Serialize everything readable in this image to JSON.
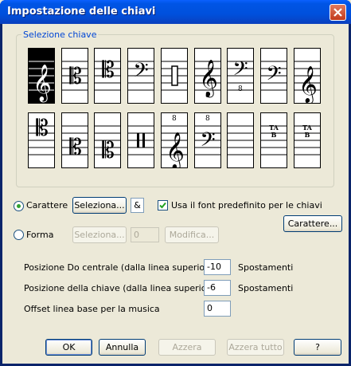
{
  "window": {
    "title": "Impostazione delle chiavi"
  },
  "clef_group": {
    "label": "Selezione chiave",
    "tiles": [
      {
        "name": "treble-clef",
        "selected": true
      },
      {
        "name": "alto-clef"
      },
      {
        "name": "tenor-clef"
      },
      {
        "name": "bass-clef"
      },
      {
        "name": "percussion-clef"
      },
      {
        "name": "treble-8vb-clef",
        "label": "8"
      },
      {
        "name": "bass-8vb-clef",
        "label": "8"
      },
      {
        "name": "baritone-f-clef"
      },
      {
        "name": "french-violin-clef"
      },
      {
        "name": "soprano-c-clef"
      },
      {
        "name": "mezzo-soprano-c-clef"
      },
      {
        "name": "baritone-c-clef"
      },
      {
        "name": "percussion-clef-2"
      },
      {
        "name": "treble-8va-clef",
        "label": "8"
      },
      {
        "name": "bass-8va-clef",
        "label": "8"
      },
      {
        "name": "blank-clef"
      },
      {
        "name": "tab-clef-4",
        "label": "TAB"
      },
      {
        "name": "tab-clef-6",
        "label": "TAB"
      }
    ]
  },
  "character": {
    "radio_label": "Carattere",
    "select_button": "Seleziona...",
    "char_value": "&",
    "use_default_font_label": "Usa il font predefinito per le chiavi",
    "font_button": "Carattere..."
  },
  "shape": {
    "radio_label": "Forma",
    "select_button": "Seleziona...",
    "char_value": "0",
    "modify_button": "Modifica..."
  },
  "fields": {
    "middle_c_label": "Posizione Do centrale (dalla linea superiore)",
    "middle_c_value": "-10",
    "middle_c_unit": "Spostamenti",
    "clef_pos_label": "Posizione della chiave (dalla linea superiore)",
    "clef_pos_value": "-6",
    "clef_pos_unit": "Spostamenti",
    "baseline_label": "Offset linea base per la musica",
    "baseline_value": "0"
  },
  "buttons": {
    "ok": "OK",
    "cancel": "Annulla",
    "reset": "Azzera",
    "reset_all": "Azzera tutto",
    "help": "?"
  }
}
